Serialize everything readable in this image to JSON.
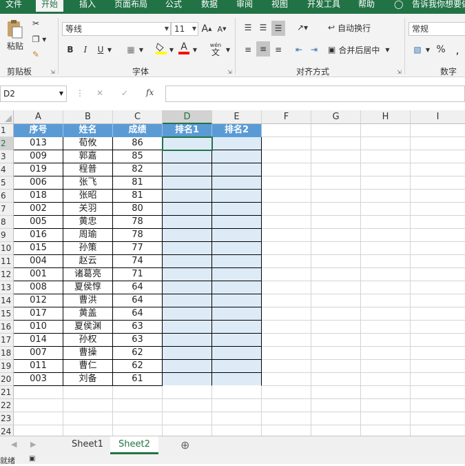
{
  "ribbon_tabs": [
    "文件",
    "开始",
    "插入",
    "页面布局",
    "公式",
    "数据",
    "审阅",
    "视图",
    "开发工具",
    "帮助"
  ],
  "tell_me": "告诉我你想要做",
  "ribbon": {
    "paste_label": "粘贴",
    "clipboard_label": "剪贴板",
    "font_label": "字体",
    "font_name": "等线",
    "font_size": "11",
    "grow_font": "A",
    "shrink_font": "A",
    "bold": "B",
    "italic": "I",
    "underline": "U",
    "font_color_glyph": "A",
    "phonetic_top": "wén",
    "phonetic_bottom": "文",
    "alignment_label": "对齐方式",
    "wrap_text": "自动换行",
    "merge_center": "合并后居中",
    "number_label": "数字",
    "number_format": "常规",
    "percent": "%",
    "comma": ","
  },
  "formula_bar": {
    "name_box": "D2",
    "fx": "fx",
    "cancel": "✕",
    "enter": "✓",
    "value": ""
  },
  "columns": [
    "A",
    "B",
    "C",
    "D",
    "E",
    "F",
    "G",
    "H",
    "I"
  ],
  "rows": [
    "1",
    "2",
    "3",
    "4",
    "5",
    "6",
    "7",
    "8",
    "9",
    "10",
    "11",
    "12",
    "13",
    "14",
    "15",
    "16",
    "17",
    "18",
    "19",
    "20",
    "21",
    "22",
    "23",
    "24"
  ],
  "headers": [
    "序号",
    "姓名",
    "成绩",
    "排名1",
    "排名2"
  ],
  "table": [
    [
      "013",
      "荀攸",
      "86"
    ],
    [
      "009",
      "郭嘉",
      "85"
    ],
    [
      "019",
      "程普",
      "82"
    ],
    [
      "006",
      "张飞",
      "81"
    ],
    [
      "018",
      "张昭",
      "81"
    ],
    [
      "002",
      "关羽",
      "80"
    ],
    [
      "005",
      "黄忠",
      "78"
    ],
    [
      "016",
      "周瑜",
      "78"
    ],
    [
      "015",
      "孙策",
      "77"
    ],
    [
      "004",
      "赵云",
      "74"
    ],
    [
      "001",
      "诸葛亮",
      "71"
    ],
    [
      "008",
      "夏侯惇",
      "64"
    ],
    [
      "012",
      "曹洪",
      "64"
    ],
    [
      "017",
      "黄盖",
      "64"
    ],
    [
      "010",
      "夏侯渊",
      "63"
    ],
    [
      "014",
      "孙权",
      "63"
    ],
    [
      "007",
      "曹操",
      "62"
    ],
    [
      "011",
      "曹仁",
      "62"
    ],
    [
      "003",
      "刘备",
      "61"
    ]
  ],
  "sheets": [
    "Sheet1",
    "Sheet2"
  ],
  "active_sheet": "Sheet2",
  "add_sheet": "⊕",
  "status_text": "就绪",
  "colors": {
    "excel_green": "#217346",
    "header_blue": "#5b9bd5",
    "light_blue": "#ddebf7"
  }
}
